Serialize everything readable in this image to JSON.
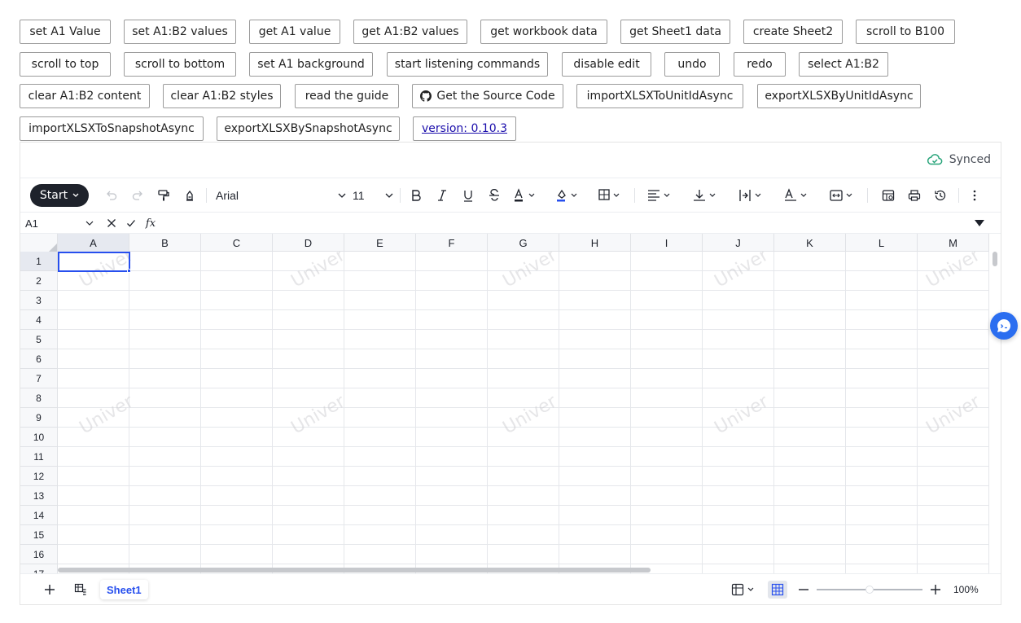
{
  "demo_buttons": {
    "row1": [
      "set A1 Value",
      "set A1:B2 values",
      "get A1 value",
      "get A1:B2 values",
      "get workbook data",
      "get Sheet1 data",
      "create Sheet2",
      "scroll to B100"
    ],
    "row2": [
      "scroll to top",
      "scroll to bottom",
      "set A1 background",
      "start listening commands",
      "disable edit",
      "undo",
      "redo",
      "select A1:B2"
    ],
    "row3": [
      "clear A1:B2 content",
      "clear A1:B2 styles",
      "read the guide",
      "Get the Source Code",
      "importXLSXToUnitIdAsync",
      "exportXLSXByUnitIdAsync"
    ],
    "row4": [
      "importXLSXToSnapshotAsync",
      "exportXLSXBySnapshotAsync",
      "version: 0.10.3"
    ]
  },
  "header": {
    "sync_status": "Synced"
  },
  "toolbar": {
    "start_label": "Start",
    "font_name": "Arial",
    "font_size": "11"
  },
  "formula_bar": {
    "cell_ref": "A1",
    "fx_label": "fx"
  },
  "grid": {
    "columns": [
      "A",
      "B",
      "C",
      "D",
      "E",
      "F",
      "G",
      "H",
      "I",
      "J",
      "K",
      "L",
      "M"
    ],
    "rows": [
      "1",
      "2",
      "3",
      "4",
      "5",
      "6",
      "7",
      "8",
      "9",
      "10",
      "11",
      "12",
      "13",
      "14",
      "15",
      "16",
      "17"
    ],
    "watermark": "Univer",
    "active_cell": "A1"
  },
  "footer": {
    "sheet_tab": "Sheet1",
    "zoom": "100%"
  },
  "colors": {
    "accent": "#274fee",
    "start_bg": "#1e222b",
    "float_btn": "#2b6ef0"
  }
}
